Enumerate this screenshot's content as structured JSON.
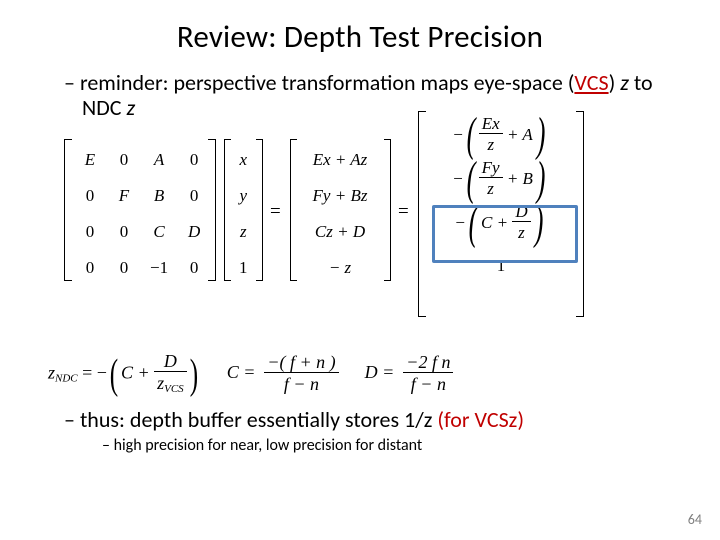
{
  "title": "Review: Depth Test Precision",
  "bullet1_pre": "reminder: perspective transformation maps eye-space (",
  "bullet1_vcs": "VCS",
  "bullet1_mid": ") ",
  "bullet1_z1": "z",
  "bullet1_mid2": " to NDC ",
  "bullet1_z2": "z",
  "matrix": {
    "r0c0": "E",
    "r0c1": "0",
    "r0c2": "A",
    "r0c3": "0",
    "r1c0": "0",
    "r1c1": "F",
    "r1c2": "B",
    "r1c3": "0",
    "r2c0": "0",
    "r2c1": "0",
    "r2c2": "C",
    "r2c3": "D",
    "r3c0": "0",
    "r3c1": "0",
    "r3c2": "−1",
    "r3c3": "0"
  },
  "vec_in": {
    "r0": "x",
    "r1": "y",
    "r2": "z",
    "r3": "1"
  },
  "eq_sign": "=",
  "vec_mid": {
    "r0": "Ex + Az",
    "r1": "Fy + Bz",
    "r2": "Cz + D",
    "r3": "− z"
  },
  "rhs_minus": "−",
  "rhs0": {
    "num": "Ex",
    "den": "z",
    "plus": "+ A"
  },
  "rhs1": {
    "num": "Fy",
    "den": "z",
    "plus": "+ B"
  },
  "rhs2": {
    "C": "C +",
    "num": "D",
    "den": "z"
  },
  "rhs3": "1",
  "formula": {
    "z_label": "z",
    "ndc": "NDC",
    "eqminus": "= −",
    "C": "C +",
    "D": "D",
    "zvcs_z": "z",
    "zvcs": "VCS",
    "C_lhs": "C =",
    "C_num": "−( f + n )",
    "C_den": "f − n",
    "D_lhs": "D =",
    "D_num": "−2 f n",
    "D_den": "f − n"
  },
  "bullet2_pre": "thus: depth buffer essentially stores 1/z ",
  "bullet2_red": "(for VCSz)",
  "bullet3": "high precision for near, low precision for distant",
  "pagenum": "64"
}
